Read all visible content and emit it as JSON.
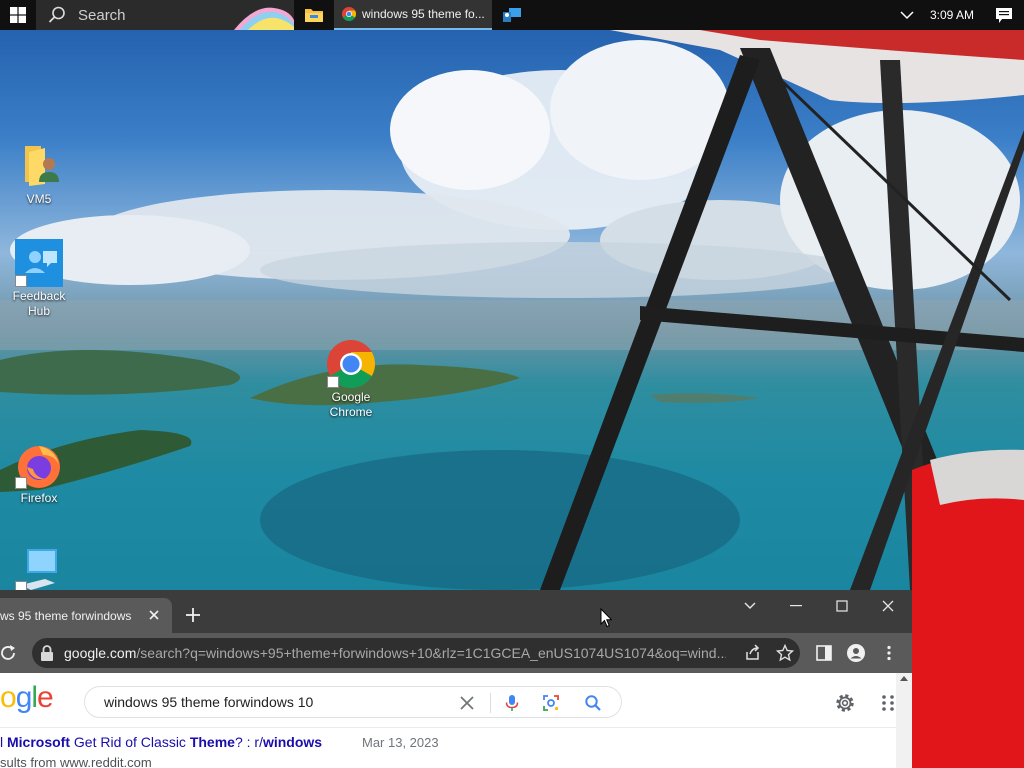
{
  "taskbar": {
    "search_placeholder": "Search",
    "chrome_task_title": "windows 95 theme fo...",
    "clock": "3:09 AM",
    "icons": [
      "windows-start-icon",
      "search-icon",
      "file-explorer-icon",
      "chrome-icon",
      "remote-desktop-icon",
      "chevron-up-icon",
      "notifications-icon"
    ]
  },
  "desktop": {
    "icons": [
      {
        "label": "VM5"
      },
      {
        "label": "Feedback Hub"
      },
      {
        "label": "Google Chrome"
      },
      {
        "label": "Firefox"
      }
    ]
  },
  "chrome": {
    "tab_title": "ws 95 theme forwindows",
    "url_host": "google.com",
    "url_rest": "/search?q=windows+95+theme+forwindows+10&rlz=1C1GCEA_enUS1074US1074&oq=wind...",
    "search_query": "windows 95 theme forwindows 10",
    "logo_text": "ogle",
    "result": {
      "title_prefix": "l ",
      "title_b1": "Microsoft",
      "title_mid": " Get Rid of Classic ",
      "title_b2": "Theme",
      "title_mid2": "? : r/",
      "title_b3": "windows",
      "date": "Mar 13, 2023",
      "sub": "sults from www.reddit.com"
    }
  },
  "colors": {
    "taskbar_bg": "#101010",
    "chrome_frame": "#3c3c3c",
    "chrome_toolbar": "#5a5a5a",
    "link": "#1a0dab",
    "google_blue": "#4285f4",
    "google_red": "#ea4335",
    "google_yellow": "#fbbc05",
    "google_green": "#34a853"
  }
}
